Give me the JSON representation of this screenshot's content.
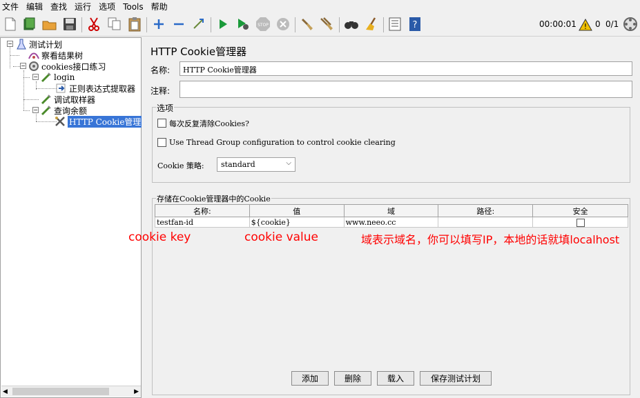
{
  "menu": [
    "文件",
    "编辑",
    "查找",
    "运行",
    "选项",
    "Tools",
    "帮助"
  ],
  "toolbar": {
    "icons": [
      "new-icon",
      "templates-icon",
      "open-icon",
      "save-icon",
      "cut-icon",
      "copy-icon",
      "paste-icon",
      "expand-icon",
      "collapse-icon",
      "toggle-icon",
      "start-icon",
      "start-no-pause-icon",
      "stop-icon",
      "shutdown-icon",
      "clear-icon",
      "clear-all-icon",
      "search-icon",
      "reset-search-icon",
      "function-helper-icon",
      "help-icon"
    ],
    "timer": "00:00:01",
    "warning_count": "0",
    "threads": "0/1"
  },
  "tree": {
    "items": [
      {
        "label": "测试计划",
        "icon": "test-plan-icon"
      },
      {
        "label": "察看结果树",
        "icon": "listener-icon"
      },
      {
        "label": "cookies接口练习",
        "icon": "thread-group-icon"
      },
      {
        "label": "login",
        "icon": "sampler-icon"
      },
      {
        "label": "正则表达式提取器",
        "icon": "extractor-icon"
      },
      {
        "label": "调试取样器",
        "icon": "sampler-icon"
      },
      {
        "label": "查询余额",
        "icon": "sampler-icon"
      },
      {
        "label": "HTTP Cookie管理器",
        "icon": "config-icon"
      }
    ]
  },
  "panel": {
    "title": "HTTP Cookie管理器",
    "name_label": "名称:",
    "name_value": "HTTP Cookie管理器",
    "comment_label": "注释:",
    "comment_value": "",
    "options_title": "选项",
    "clear_each_iteration": "每次反复清除Cookies?",
    "use_thread_group": "Use Thread Group configuration to control cookie clearing",
    "policy_label": "Cookie 策略:",
    "policy_value": "standard",
    "stored_title": "存储在Cookie管理器中的Cookie",
    "columns": [
      "名称:",
      "值",
      "域",
      "路径:",
      "安全"
    ],
    "rows": [
      {
        "name": "testfan-id",
        "value": "${cookie}",
        "domain": "www.neeo.cc",
        "path": "",
        "secure": false
      }
    ],
    "buttons": [
      "添加",
      "删除",
      "载入",
      "保存测试计划"
    ]
  },
  "annotations": {
    "key": "cookie key",
    "value": "cookie value",
    "domain": "域表示域名，你可以填写IP，本地的话就填localhost"
  },
  "colors": {
    "annotation": "#ff0000",
    "selection": "#3875d7",
    "run_green": "#1a9a3a"
  }
}
